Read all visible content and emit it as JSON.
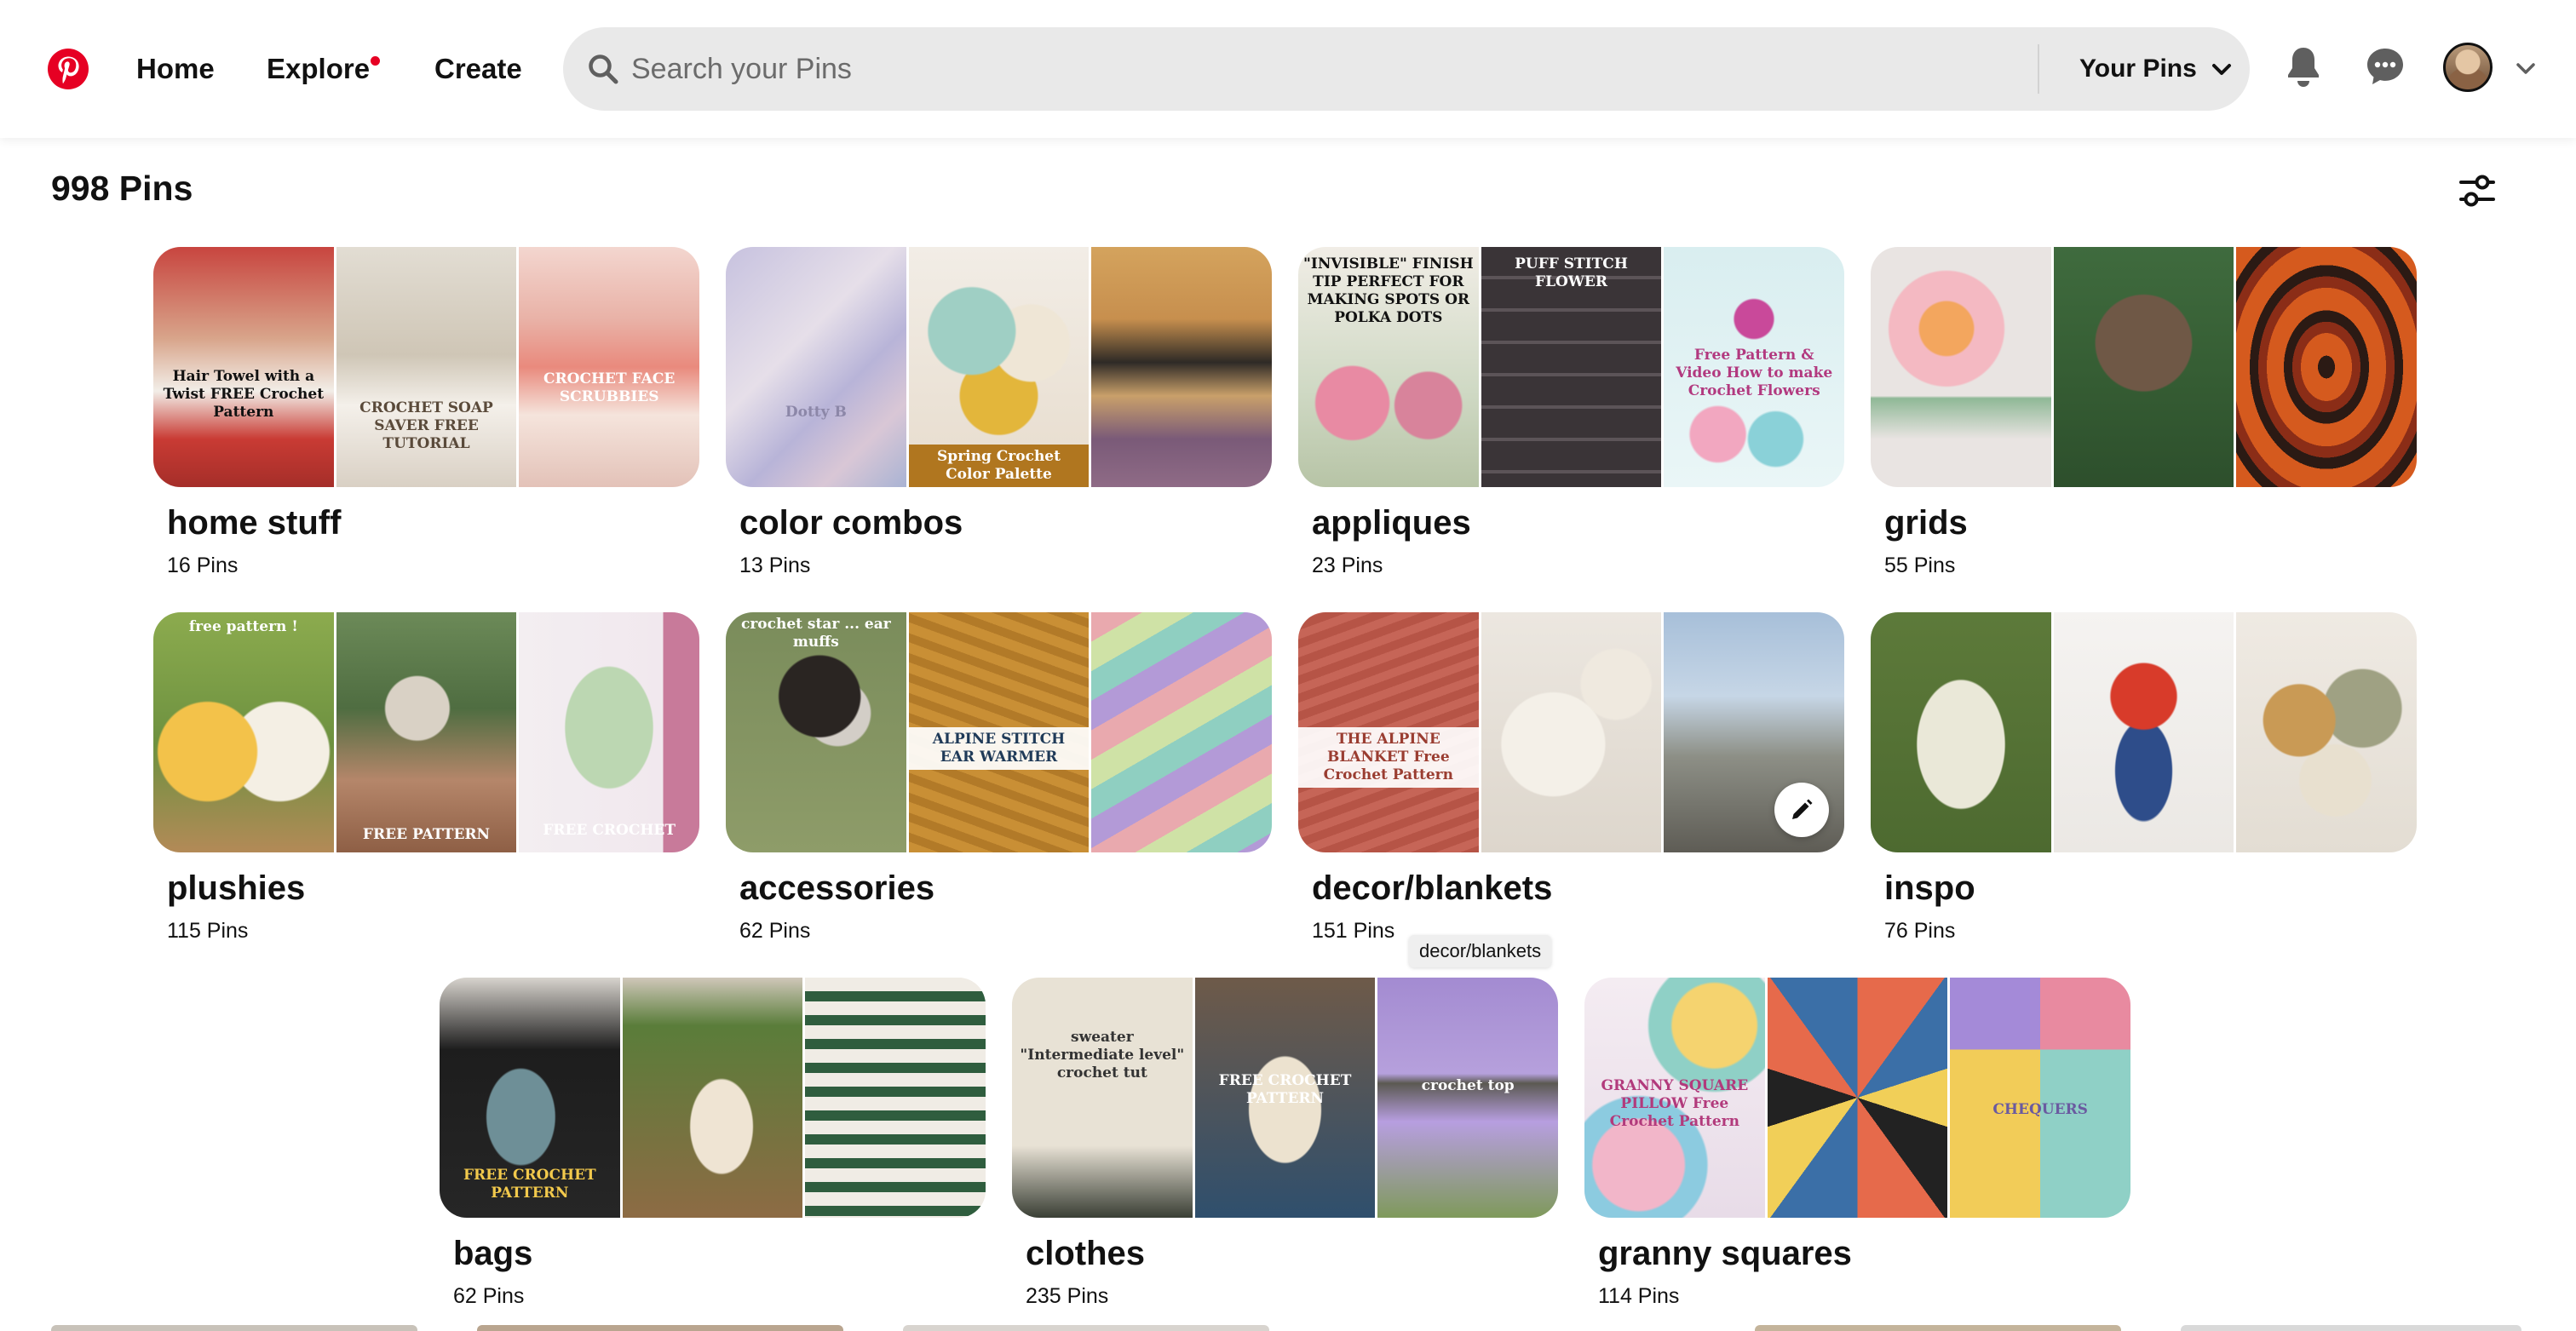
{
  "header": {
    "logo": "pinterest-logo",
    "nav": [
      {
        "label": "Home"
      },
      {
        "label": "Explore",
        "has_notification_dot": true
      },
      {
        "label": "Create"
      }
    ],
    "search": {
      "placeholder": "Search your Pins",
      "value": ""
    },
    "scope_dropdown": {
      "label": "Your Pins"
    },
    "icons": [
      "bell-icon",
      "message-icon",
      "avatar",
      "chevron-down-icon"
    ],
    "accent": "#e60023"
  },
  "pins_count": "998 Pins",
  "boards": [
    {
      "name": "home stuff",
      "count": "16 Pins",
      "tiles": [
        {
          "bg": "linear-gradient(180deg,#c8453f 0%,#d8a48a 38%,#f2eee8 60%,#c93b34 80%,#a52e29 100%)",
          "caption": "Hair Towel with a Twist FREE Crochet Pattern",
          "cap_pos": "top:49%",
          "cap_color": "#111"
        },
        {
          "bg": "linear-gradient(180deg,#e2ddd3 0%,#cfc6b6 45%,#f4f0ea 66%,#d9d0c4 100%)",
          "caption": "CROCHET SOAP SAVER FREE TUTORIAL",
          "cap_pos": "top:62%",
          "cap_color": "#5a4a3a"
        },
        {
          "bg": "linear-gradient(180deg,#f3d6cf 0%,#e9b2a7 30%,#e98a7d 50%,#f5e4dc 70%,#e3c2b8 100%)",
          "caption": "CROCHET FACE SCRUBBIES",
          "cap_pos": "top:50%",
          "cap_color": "#ffffff"
        }
      ]
    },
    {
      "name": "color combos",
      "count": "13 Pins",
      "tiles": [
        {
          "bg": "linear-gradient(135deg,#c7c2df 0%,#e6dfe9 40%,#b8b4d8 62%,#d9c7d6 80%,#a9b3d3 100%)",
          "caption": "Dotty B",
          "cap_pos": "top:64%",
          "cap_color": "#8c87a8"
        },
        {
          "bg": "radial-gradient(circle at 35% 35%,#9fcfc4 0 22%,transparent 23%),radial-gradient(circle at 68% 40%,#efe6d6 0 20%,transparent 21%),radial-gradient(circle at 50% 62%,#e3b63b 0 22%,transparent 23%),linear-gradient(180deg,#f2ede6,#e7dccd)",
          "caption": "Spring Crochet Color Palette",
          "cap_pos": "bottom:0;background:#b0761f",
          "cap_color": "#ffffff"
        },
        {
          "bg": "linear-gradient(180deg,#d4a35d 0%,#c78f4e 30%,#2e2a26 48%,#c9a06a 62%,#7a5a78 80%,#8f6b86 100%)",
          "caption": "",
          "cap_pos": "top:40%",
          "cap_color": "#ffffff"
        }
      ]
    },
    {
      "name": "appliques",
      "count": "23 Pins",
      "tiles": [
        {
          "bg": "radial-gradient(circle at 30% 65%,#e88aa3 0 18%,transparent 19%),radial-gradient(circle at 72% 66%,#d8839b 0 16%,transparent 17%),linear-gradient(180deg,#f1ede6 0%,#cfd9c4 60%,#b7c4a6 100%)",
          "caption": "\"INVISIBLE\" FINISH TIP PERFECT FOR MAKING SPOTS OR POLKA DOTS",
          "cap_pos": "top:2%",
          "cap_color": "#111"
        },
        {
          "bg": "repeating-linear-gradient(180deg,#3a3437 0 34px,#5c5458 34px 38px),linear-gradient(#3a3437,#3a3437)",
          "caption": "PUFF STITCH FLOWER",
          "cap_pos": "top:2%",
          "cap_color": "#ffffff"
        },
        {
          "bg": "radial-gradient(circle at 30% 78%,#f2a7c0 0 12%,transparent 13%),radial-gradient(circle at 62% 80%,#8ad1d8 0 12%,transparent 13%),radial-gradient(circle at 50% 30%,#c9499a 0 10%,transparent 11%),linear-gradient(180deg,#d9eef0 0%,#eaf6f7 100%)",
          "caption": "Free Pattern & Video How to make Crochet Flowers",
          "cap_pos": "top:40%",
          "cap_color": "#b2397f"
        }
      ]
    },
    {
      "name": "grids",
      "count": "55 Pins",
      "tiles": [
        {
          "bg": "radial-gradient(circle at 42% 34%,#f3a65e 0 14%,transparent 15%),radial-gradient(circle at 42% 34%,#f4b9c2 0 30%,transparent 31%),linear-gradient(180deg,#e9e4e2 0%,#e9e4e2 62%,#8fb896 63%,#e9e4e2 80%)",
          "caption": "",
          "cap_pos": "top:0",
          "cap_color": "#111"
        },
        {
          "bg": "radial-gradient(circle at 50% 40%,#6f5846 0 28%,transparent 29%),linear-gradient(180deg,#3f6b3e 0%,#365e34 50%,#2d4f2c 100%)",
          "caption": "",
          "cap_pos": "top:0",
          "cap_color": "#111"
        },
        {
          "bg": "repeating-radial-gradient(ellipse at 50% 50%,#2b1a14 0 10px,#d55a1e 10px 30px,#8b2d17 30px 40px)",
          "caption": "",
          "cap_pos": "top:0",
          "cap_color": "#111"
        }
      ]
    },
    {
      "name": "plushies",
      "count": "115 Pins",
      "tiles": [
        {
          "bg": "radial-gradient(circle at 30% 58%,#f3c24a 0 26%,transparent 27%),radial-gradient(circle at 70% 58%,#f4efe4 0 26%,transparent 27%),linear-gradient(180deg,#8cab4e 0%,#6d9140 55%,#b38a57 100%)",
          "caption": "free pattern !",
          "cap_pos": "top:1%",
          "cap_color": "#ffffff"
        },
        {
          "bg": "radial-gradient(circle at 45% 40%,#d9d1c5 0 18%,transparent 19%),linear-gradient(180deg,#6c8a58 0%,#4f6d41 40%,#b5866a 70%,#8e5f45 100%)",
          "caption": "FREE PATTERN",
          "cap_pos": "bottom:2%",
          "cap_color": "#ffffff"
        },
        {
          "bg": "radial-gradient(ellipse at 50% 48%,#bcd7b2 0 34%,transparent 35%),linear-gradient(90deg,#f3eef1 0%,#f1e8ee 80%,#c87a9a 80%,#c87a9a 100%)",
          "caption": "FREE CROCHET",
          "cap_pos": "bottom:4%",
          "cap_color": "#ffffff"
        }
      ]
    },
    {
      "name": "accessories",
      "count": "62 Pins",
      "tiles": [
        {
          "bg": "radial-gradient(circle at 52% 35%,#2a2522 0 22%,transparent 23%),radial-gradient(circle at 62% 42%,#d3cec7 0 18%,transparent 19%),linear-gradient(180deg,#7a8c5b 0%,#8e9c69 100%)",
          "caption": "crochet star ... ear muffs",
          "cap_pos": "top:0",
          "cap_color": "#ffffff"
        },
        {
          "bg": "repeating-linear-gradient(20deg,#c98f35 0 12px,#b27a28 12px 22px)",
          "caption": "ALPINE STITCH EAR WARMER",
          "cap_pos": "top:48%;background:rgba(255,255,255,0.92)",
          "cap_color": "#1f3a58"
        },
        {
          "bg": "repeating-linear-gradient(150deg,#e9a9ae 0 30px,#cfe2a6 30px 60px,#8fcfc1 60px 90px,#b39ad7 90px 120px)",
          "caption": "",
          "cap_pos": "top:0",
          "cap_color": "#111"
        }
      ]
    },
    {
      "name": "decor/blankets",
      "count": "151 Pins",
      "tiles": [
        {
          "bg": "repeating-linear-gradient(160deg,#c66557 0 10px,#b65446 10px 20px)",
          "caption": "THE ALPINE BLANKET Free Crochet Pattern",
          "cap_pos": "top:48%;background:rgba(255,255,255,0.92)",
          "cap_color": "#9a3d31"
        },
        {
          "bg": "radial-gradient(circle at 40% 55%,#f4f0e8 0 30%,transparent 31%),radial-gradient(circle at 75% 30%,#efe9df 0 16%,transparent 17%),linear-gradient(180deg,#ece7e0,#ddd6cc)",
          "caption": "",
          "cap_pos": "top:0",
          "cap_color": "#111"
        },
        {
          "bg": "linear-gradient(180deg,#a7bfd9 0%,#c6d6e6 35%,#8d8f86 60%,#5e5c55 100%)",
          "caption": "",
          "cap_pos": "top:0",
          "cap_color": "#111"
        }
      ],
      "edit_button": true
    },
    {
      "name": "inspo",
      "count": "76 Pins",
      "tiles": [
        {
          "bg": "radial-gradient(ellipse at 50% 55%,#eae8d8 0 34%,transparent 35%),linear-gradient(180deg,#5d7a3a 0%,#4d6a30 100%)",
          "caption": "",
          "cap_pos": "top:0",
          "cap_color": "#111"
        },
        {
          "bg": "radial-gradient(circle at 50% 35%,#d83b2a 0 18%,transparent 19%),radial-gradient(ellipse at 50% 66%,#2e4d8a 0 22%,transparent 23%),linear-gradient(180deg,#f5f3f1,#ebe8e4)",
          "caption": "",
          "cap_pos": "top:0",
          "cap_color": "#111"
        },
        {
          "bg": "radial-gradient(circle at 35% 45%,#c99a55 0 20%,transparent 21%),radial-gradient(circle at 70% 40%,#9fa183 0 20%,transparent 21%),radial-gradient(circle at 55% 70%,#e8e0cf 0 18%,transparent 19%),linear-gradient(180deg,#efeae3,#e3ddd3)",
          "caption": "",
          "cap_pos": "top:0",
          "cap_color": "#111"
        }
      ]
    },
    {
      "name": "bags",
      "count": "62 Pins",
      "tiles": [
        {
          "bg": "radial-gradient(ellipse at 45% 58%,#6e8f97 0 24%,transparent 25%),linear-gradient(180deg,#d7d3cd 0%,#1d1d1d 30%,#262626 100%)",
          "caption": "FREE CROCHET PATTERN",
          "cap_pos": "bottom:5%",
          "cap_color": "#f2c94c"
        },
        {
          "bg": "radial-gradient(ellipse at 55% 62%,#efe4d3 0 22%,transparent 23%),linear-gradient(180deg,#cfc7b9 0%,#5a7d3a 20%,#8d6b44 100%)",
          "caption": "",
          "cap_pos": "top:0",
          "cap_color": "#111"
        },
        {
          "bg": "repeating-linear-gradient(180deg,#f0ece5 0 16px,#2f5d3e 16px 28px),linear-gradient(#efeae3,#efeae3)",
          "caption": "",
          "cap_pos": "top:0",
          "cap_color": "#111"
        }
      ]
    },
    {
      "name": "clothes",
      "count": "235 Pins",
      "tiles": [
        {
          "bg": "linear-gradient(180deg,#e8e2d5 0%,#e8e2d5 70%,#3a3f35 100%)",
          "caption": "sweater \"Intermediate level\" crochet tut",
          "cap_pos": "top:20%",
          "cap_color": "#333"
        },
        {
          "bg": "radial-gradient(ellipse at 50% 55%,#ece2cf 0 28%,transparent 29%),linear-gradient(180deg,#6e5a49 0%,#2f4f6d 100%)",
          "caption": "FREE CROCHET PATTERN",
          "cap_pos": "top:38%",
          "cap_color": "#ffffff"
        },
        {
          "bg": "linear-gradient(180deg,#a38bd1 0%,#b6a0dc 40%,#5b5952 44%,#b79ee0 60%,#7f9a5b 100%)",
          "caption": "crochet top",
          "cap_pos": "top:40%",
          "cap_color": "#ffffff"
        }
      ]
    },
    {
      "name": "granny squares",
      "count": "114 Pins",
      "tiles": [
        {
          "bg": "radial-gradient(circle at 30% 78%,#f2b6c9 0 20%,#8ccbe0 21% 30%,transparent 31%),radial-gradient(circle at 72% 20%,#f5d36f 0 18%,#8fd0c6 19% 28%,transparent 29%),linear-gradient(180deg,#f4ecf2,#e8dce8)",
          "caption": "GRANNY SQUARE PILLOW Free Crochet Pattern",
          "cap_pos": "top:40%",
          "cap_color": "#b23a7c"
        },
        {
          "bg": "repeating-conic-gradient(#e66a4b 0 10%,#3b6fa7 10% 20%,#f1cf58 20% 30%,#222 30% 40%)",
          "caption": "",
          "cap_pos": "top:0",
          "cap_color": "#111"
        },
        {
          "bg": "conic-gradient(from 0deg at 50% 30%,#e88aa0 0 25%,#8fd0c6 25% 50%,#f2cc58 50% 75%,#a48ad8 75% 100%)",
          "caption": "CHEQUERS",
          "cap_pos": "top:50%",
          "cap_color": "#6a5aa0"
        }
      ]
    }
  ],
  "tooltip": "decor/blankets"
}
